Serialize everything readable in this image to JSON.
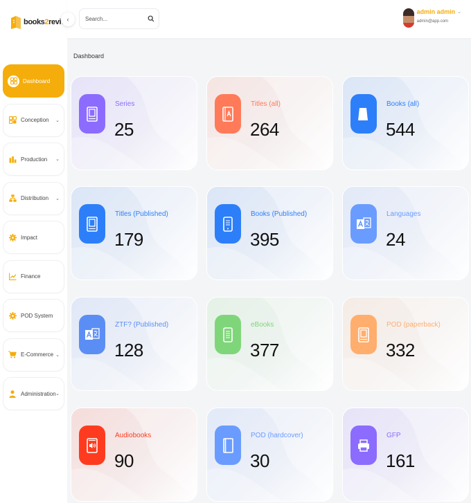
{
  "brand": {
    "logo_text_main": "books",
    "logo_text_accent": "2",
    "logo_text_end": "revival"
  },
  "sidebar": {
    "items": [
      {
        "label": "Dashboard",
        "icon": "dashboard-icon",
        "active": true,
        "chevron": false
      },
      {
        "label": "Conception",
        "icon": "grid-icon",
        "active": false,
        "chevron": true
      },
      {
        "label": "Production",
        "icon": "bar-chart-icon",
        "active": false,
        "chevron": true
      },
      {
        "label": "Distribution",
        "icon": "network-icon",
        "active": false,
        "chevron": true
      },
      {
        "label": "Impact",
        "icon": "gear-icon",
        "active": false,
        "chevron": false
      },
      {
        "label": "Finance",
        "icon": "line-chart-icon",
        "active": false,
        "chevron": false
      },
      {
        "label": "POD System",
        "icon": "gear-icon",
        "active": false,
        "chevron": false
      },
      {
        "label": "E-Commerce",
        "icon": "cart-icon",
        "active": false,
        "chevron": true
      },
      {
        "label": "Administration",
        "icon": "user-icon",
        "active": false,
        "chevron": true
      }
    ],
    "chevron_glyph": "⌄",
    "collapse_glyph": "‹"
  },
  "header": {
    "search_placeholder": "Search...",
    "user_name": "admin admin",
    "user_email": "admin@app.com",
    "user_chevron": "⌄"
  },
  "main": {
    "title": "Dashboard",
    "cards": [
      {
        "label": "Series",
        "value": "25",
        "color": "#8b6cff",
        "icon": "book-icon"
      },
      {
        "label": "Titles (all)",
        "value": "264",
        "color": "#ff7a59",
        "icon": "book-title-icon"
      },
      {
        "label": "Books (all)",
        "value": "544",
        "color": "#2d7ff9",
        "icon": "book-stand-icon"
      },
      {
        "label": "Titles (Published)",
        "value": "179",
        "color": "#2d7ff9",
        "icon": "book-icon"
      },
      {
        "label": "Books (Published)",
        "value": "395",
        "color": "#2d7ff9",
        "icon": "tablet-icon"
      },
      {
        "label": "Languages",
        "value": "24",
        "color": "#6a9cff",
        "icon": "translate-icon"
      },
      {
        "label": "ZTF? (Published)",
        "value": "128",
        "color": "#5b8ef5",
        "icon": "translate-icon"
      },
      {
        "label": "eBooks",
        "value": "377",
        "color": "#7fd67a",
        "icon": "ebook-icon"
      },
      {
        "label": "POD (paperback)",
        "value": "332",
        "color": "#ffae6e",
        "icon": "paperback-icon"
      },
      {
        "label": "Audiobooks",
        "value": "90",
        "color": "#ff3b1f",
        "icon": "audiobook-icon"
      },
      {
        "label": "POD (hardcover)",
        "value": "30",
        "color": "#6a9cff",
        "icon": "hardcover-icon"
      },
      {
        "label": "GFP",
        "value": "161",
        "color": "#8b6cff",
        "icon": "printer-icon"
      }
    ]
  }
}
